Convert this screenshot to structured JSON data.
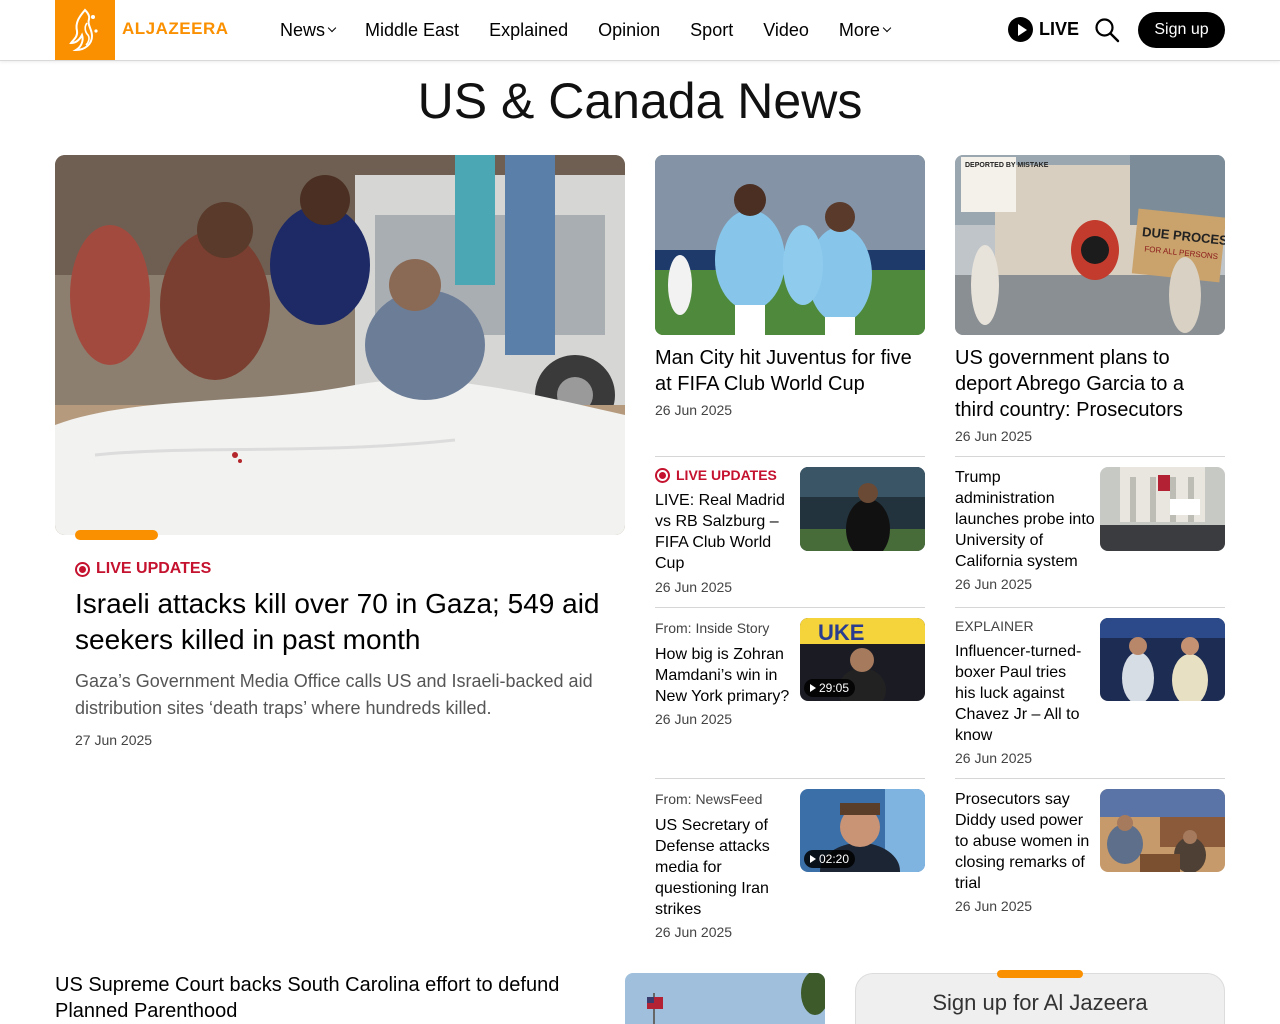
{
  "header": {
    "logo_text": "ALJAZEERA",
    "nav": [
      {
        "label": "News",
        "dropdown": true
      },
      {
        "label": "Middle East",
        "dropdown": false
      },
      {
        "label": "Explained",
        "dropdown": false
      },
      {
        "label": "Opinion",
        "dropdown": false
      },
      {
        "label": "Sport",
        "dropdown": false
      },
      {
        "label": "Video",
        "dropdown": false
      },
      {
        "label": "More",
        "dropdown": true
      }
    ],
    "live_label": "LIVE",
    "signup_label": "Sign up"
  },
  "page_title": "US & Canada News",
  "lead": {
    "tag": "LIVE UPDATES",
    "headline": "Israeli attacks kill over 70 in Gaza; 549 aid seekers killed in past month",
    "summary": "Gaza’s Government Media Office calls US and Israeli-backed aid distribution sites ‘death traps’ where hundreds killed.",
    "date": "27 Jun 2025"
  },
  "col2": {
    "top": {
      "headline": "Man City hit Juventus for five at FIFA Club World Cup",
      "date": "26 Jun 2025"
    },
    "items": [
      {
        "tag": "LIVE UPDATES",
        "headline": "LIVE: Real Madrid vs RB Salzburg – FIFA Club World Cup",
        "date": "26 Jun 2025"
      },
      {
        "kicker": "From: Inside Story",
        "headline": "How big is Zohran Mamdani’s win in New York primary?",
        "date": "26 Jun 2025",
        "duration": "29:05"
      },
      {
        "kicker": "From: NewsFeed",
        "headline": "US Secretary of Defense attacks media for questioning Iran strikes",
        "date": "26 Jun 2025",
        "duration": "02:20"
      }
    ]
  },
  "col3": {
    "top": {
      "headline": "US government plans to deport Abrego Garcia to a third country: Prosecutors",
      "date": "26 Jun 2025"
    },
    "items": [
      {
        "headline": "Trump administration launches probe into University of California system",
        "date": "26 Jun 2025"
      },
      {
        "kicker": "EXPLAINER",
        "headline": "Influencer-turned-boxer Paul tries his luck against Chavez Jr – All to know",
        "date": "26 Jun 2025"
      },
      {
        "headline": "Prosecutors say Diddy used power to abuse women in closing remarks of trial",
        "date": "26 Jun 2025"
      }
    ]
  },
  "bottom": {
    "headline": "US Supreme Court backs South Carolina effort to defund Planned Parenthood",
    "newsletter_title": "Sign up for Al Jazeera"
  },
  "images": {
    "protest_sign_1": "DUE PROCESS",
    "protest_sign_2": "FOR ALL PERSONS",
    "protest_sign_3": "DEPORTED BY MISTAKE"
  },
  "colors": {
    "brand_orange": "#fa9000",
    "live_red": "#c4122f"
  }
}
